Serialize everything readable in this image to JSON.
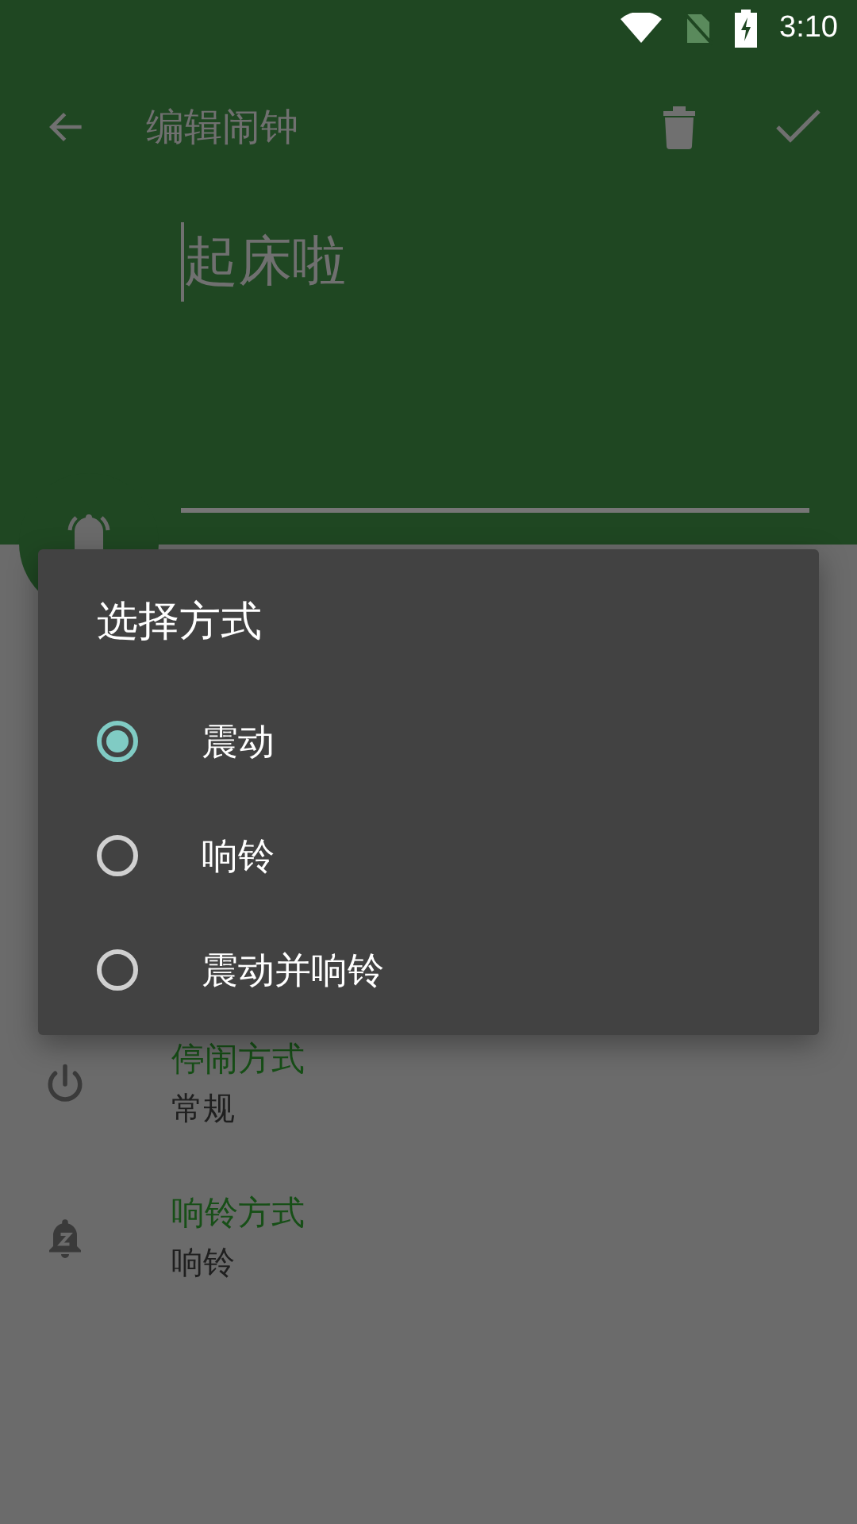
{
  "status_bar": {
    "time": "3:10"
  },
  "toolbar": {
    "title": "编辑闹钟"
  },
  "alarm_name": {
    "value": "起床啦"
  },
  "settings": [
    {
      "kind": "power",
      "title": "停闹方式",
      "value": "常规"
    },
    {
      "kind": "bell",
      "title": "响铃方式",
      "value": "响铃"
    }
  ],
  "dialog": {
    "title": "选择方式",
    "options": [
      {
        "label": "震动",
        "selected": true
      },
      {
        "label": "响铃",
        "selected": false
      },
      {
        "label": "震动并响铃",
        "selected": false
      }
    ]
  }
}
